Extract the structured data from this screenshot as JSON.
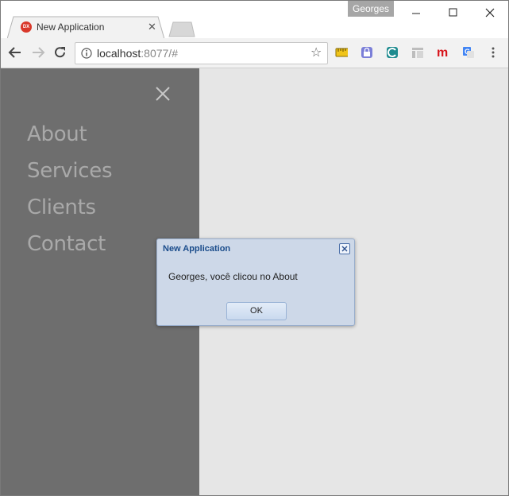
{
  "browser": {
    "profile_name": "Georges",
    "tab_title": "New Application",
    "tab_favicon": "DX",
    "url_host": "localhost",
    "url_rest": ":8077/#"
  },
  "sidebar": {
    "items": [
      {
        "label": "About"
      },
      {
        "label": "Services"
      },
      {
        "label": "Clients"
      },
      {
        "label": "Contact"
      }
    ]
  },
  "dialog": {
    "title": "New Application",
    "message": "Georges, você clicou no About",
    "ok_label": "OK"
  },
  "colors": {
    "sidebar_bg": "#6e6e6e",
    "page_bg": "#e6e6e6",
    "dialog_bg": "#cdd8e8",
    "dialog_title": "#1a4c8b"
  }
}
